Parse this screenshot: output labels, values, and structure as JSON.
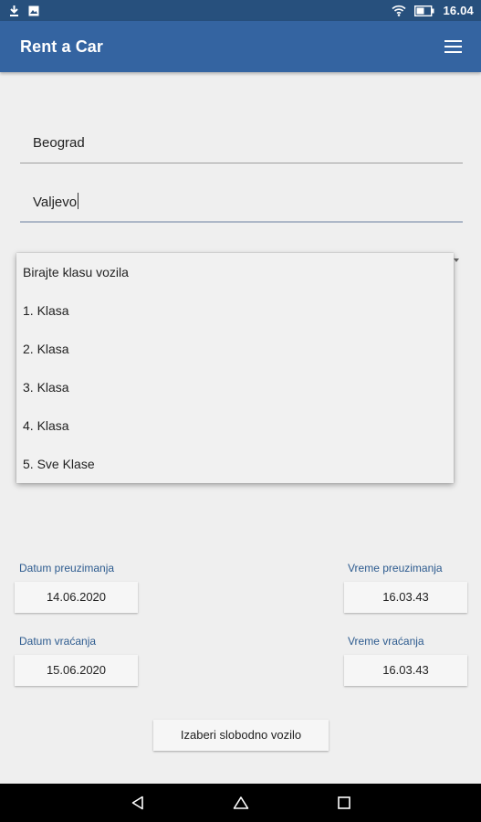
{
  "status_bar": {
    "time": "16.04",
    "icons": [
      "download-icon",
      "image-icon",
      "wifi-icon",
      "battery-icon"
    ]
  },
  "app_bar": {
    "title": "Rent a Car",
    "menu_icon": "hamburger-menu-icon"
  },
  "form": {
    "from_value": "Beograd",
    "to_value": "Valjevo"
  },
  "class_dropdown": {
    "options": [
      "Birajte klasu vozila",
      "1. Klasa",
      "2. Klasa",
      "3. Klasa",
      "4. Klasa",
      "5. Sve Klase"
    ]
  },
  "pickup": {
    "date_label": "Datum preuzimanja",
    "date_value": "14.06.2020",
    "time_label": "Vreme preuzimanja",
    "time_value": "16.03.43"
  },
  "return": {
    "date_label": "Datum vraćanja",
    "date_value": "15.06.2020",
    "time_label": "Vreme vraćanja",
    "time_value": "16.03.43"
  },
  "actions": {
    "choose_vehicle": "Izaberi slobodno vozilo"
  },
  "nav_bar": {
    "icons": [
      "back-icon",
      "home-icon",
      "recent-apps-icon"
    ]
  },
  "colors": {
    "status_bar": "#27507d",
    "app_bar": "#3464a1",
    "label_blue": "#2d5b8f",
    "background": "#efefef"
  }
}
